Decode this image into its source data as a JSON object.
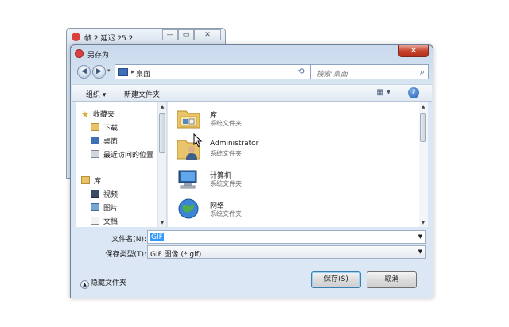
{
  "background_window": {
    "title": "帧 2 延迟 25.2",
    "min": "—",
    "max": "▭",
    "close": "✕"
  },
  "dialog": {
    "title": "另存为",
    "close": "✕",
    "back": "◀",
    "forward": "▶",
    "address": {
      "separator": "▸",
      "location": "桌面",
      "dropdown": "▾"
    },
    "refresh": "⟲",
    "search": {
      "placeholder": "搜索 桌面",
      "icon": "⌕"
    },
    "toolbar": {
      "organize": "组织 ▾",
      "new_folder": "新建文件夹",
      "views": "▦ ▾",
      "help": "?"
    },
    "nav": {
      "favorites": "收藏夹",
      "downloads": "下载",
      "desktop": "桌面",
      "recent": "最近访问的位置",
      "libraries": "库",
      "videos": "视频",
      "pictures": "图片",
      "documents": "文档"
    },
    "files": [
      {
        "name": "库",
        "type": "系统文件夹",
        "icon": "library-icon"
      },
      {
        "name": "Administrator",
        "type": "系统文件夹",
        "icon": "user-folder-icon"
      },
      {
        "name": "计算机",
        "type": "系统文件夹",
        "icon": "computer-icon"
      },
      {
        "name": "网络",
        "type": "系统文件夹",
        "icon": "network-icon"
      }
    ],
    "filename": {
      "label": "文件名(N):",
      "value": "GIF"
    },
    "filetype": {
      "label": "保存类型(T):",
      "value": "GIF 图像 (*.gif)"
    },
    "hide_folders": "隐藏文件夹",
    "save": "保存(S)",
    "cancel": "取消",
    "arrow_up": "▲",
    "arrow_down": "▼"
  }
}
